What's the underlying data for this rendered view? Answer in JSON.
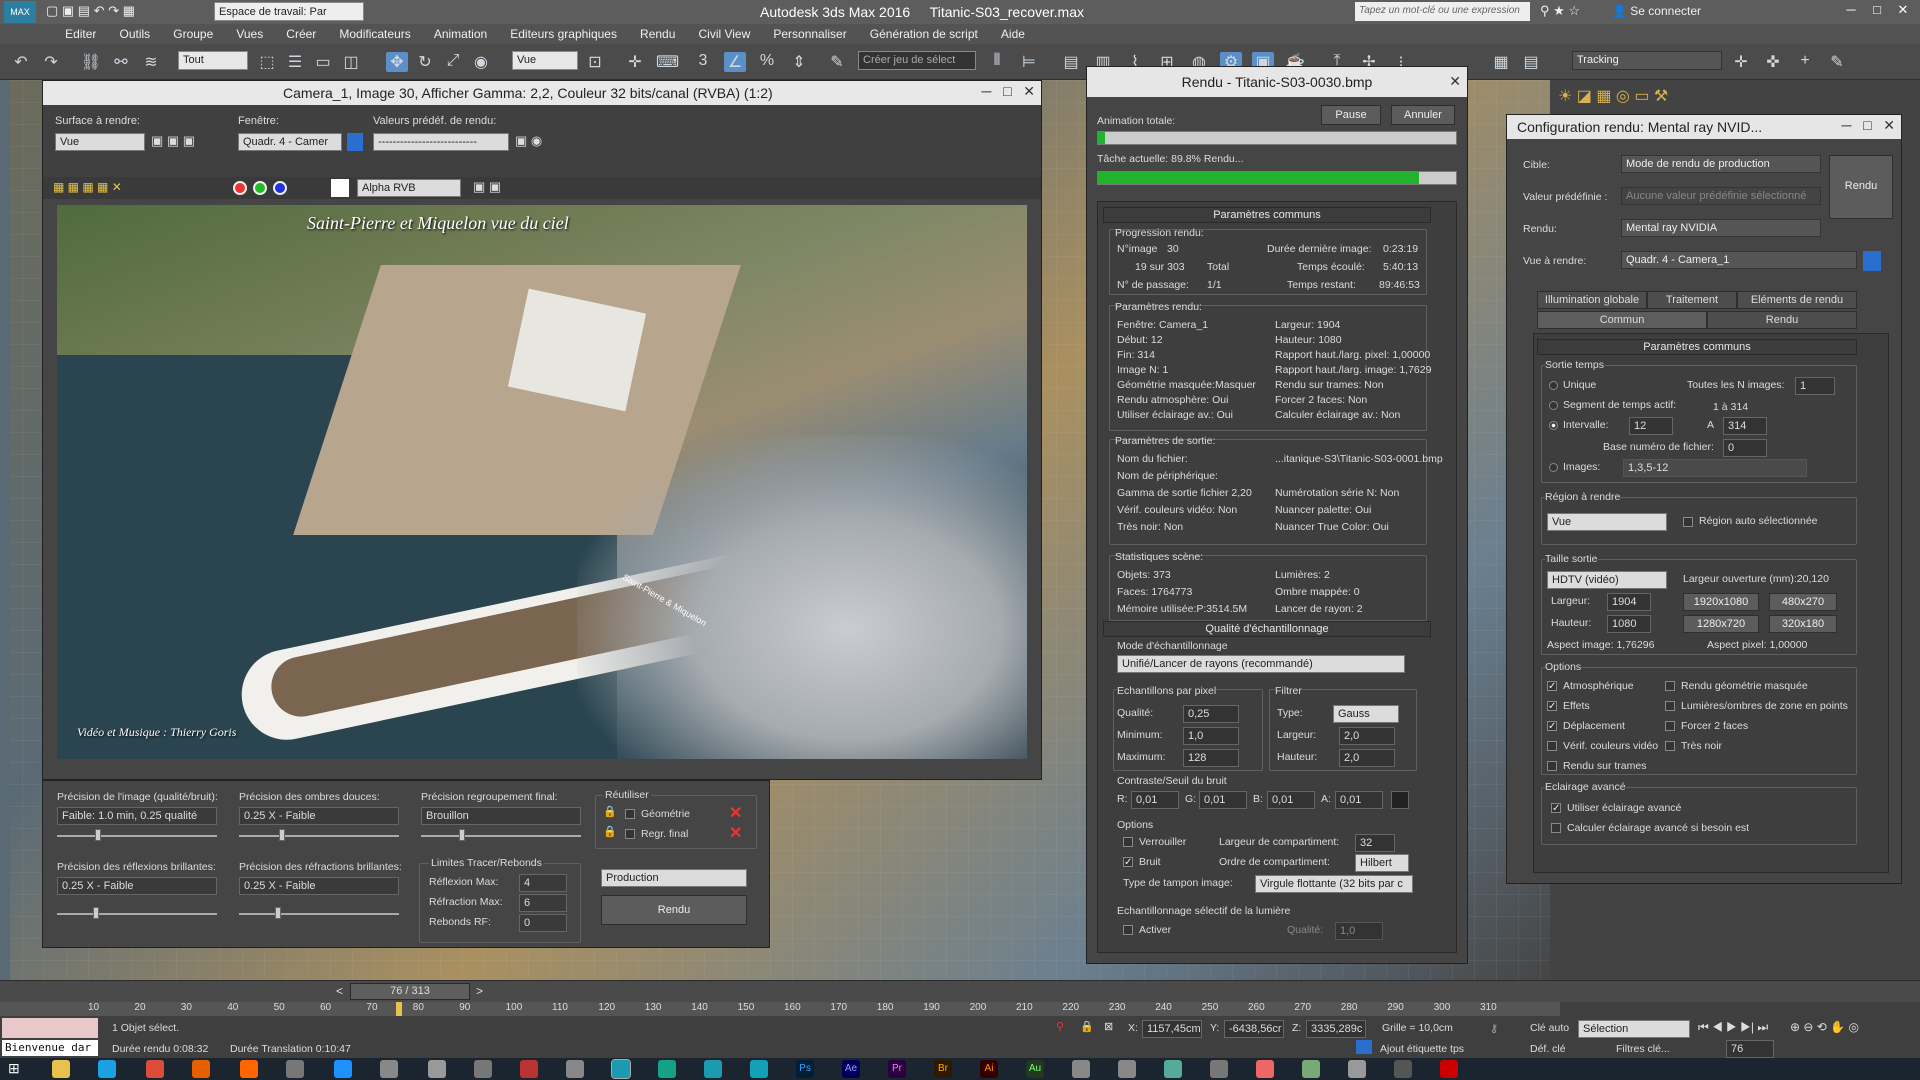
{
  "app": {
    "title": "Autodesk 3ds Max 2016",
    "file": "Titanic-S03_recover.max",
    "workspace": "Espace de travail: Par",
    "search_placeholder": "Tapez un mot-clé ou une expression",
    "connect": "Se connecter"
  },
  "menu": [
    "Editer",
    "Outils",
    "Groupe",
    "Vues",
    "Créer",
    "Modificateurs",
    "Animation",
    "Editeurs graphiques",
    "Rendu",
    "Civil View",
    "Personnaliser",
    "Génération de script",
    "Aide"
  ],
  "toolbar": {
    "selection_filter": "Tout",
    "view_ref": "Vue",
    "named_sel": "Créer jeu de sélect",
    "tracking": "Tracking"
  },
  "framewin": {
    "title": "Camera_1, Image 30, Afficher Gamma: 2,2, Couleur 32 bits/canal (RVBA) (1:2)",
    "area_label": "Surface à rendre:",
    "area_value": "Vue",
    "window_label": "Fenêtre:",
    "window_value": "Quadr. 4 - Camer",
    "preset_label": "Valeurs prédéf. de rendu:",
    "preset_value": "---------------------------",
    "channel": "Alpha RVB",
    "caption": "Saint-Pierre et Miquelon vue du ciel",
    "credit": "Vidéo et Musique : Thierry Goris",
    "ship_text": "Saint-Pierre & Miquelon"
  },
  "fg": {
    "img_prec_label": "Précision de l'image (qualité/bruit):",
    "img_prec_value": "Faible: 1.0 min, 0.25 qualité",
    "soft_shadow_label": "Précision des ombres douces:",
    "soft_shadow_value": "0.25 X - Faible",
    "final_gather_label": "Précision regroupement final:",
    "final_gather_value": "Brouillon",
    "glossy_refl_label": "Précision des réflexions brillantes:",
    "glossy_refl_value": "0.25 X - Faible",
    "glossy_refr_label": "Précision des réfractions brillantes:",
    "glossy_refr_value": "0.25 X - Faible",
    "trace_label": "Limites Tracer/Rebonds",
    "refl_max_label": "Réflexion Max:",
    "refl_max": "4",
    "refr_max_label": "Réfraction Max:",
    "refr_max": "6",
    "bounces_label": "Rebonds RF:",
    "bounces": "0",
    "reuse_label": "Réutiliser",
    "geometry": "Géométrie",
    "final_reg": "Regr. final",
    "mode": "Production",
    "render": "Rendu"
  },
  "render": {
    "title": "Rendu - Titanic-S03-0030.bmp",
    "anim_total": "Animation totale:",
    "pause": "Pause",
    "cancel": "Annuler",
    "anim_progress": 0.02,
    "task": "Tâche actuelle: 89.8% Rendu...",
    "task_progress": 0.898,
    "common": "Paramètres communs",
    "prog_title": "Progression rendu:",
    "prog": [
      [
        "N°image",
        "30"
      ],
      [
        "Durée dernière image:",
        "0:23:19"
      ],
      [
        "19 sur 303",
        "Total"
      ],
      [
        "Temps écoulé:",
        "5:40:13"
      ],
      [
        "N° de passage:",
        "1/1"
      ],
      [
        "Temps restant:",
        "89:46:53"
      ]
    ],
    "rp_title": "Paramètres rendu:",
    "rp": [
      [
        "Fenêtre: Camera_1",
        "Largeur: 1904"
      ],
      [
        "Début: 12",
        "Hauteur: 1080"
      ],
      [
        "Fin: 314",
        "Rapport haut./larg. pixel: 1,00000"
      ],
      [
        "Image N: 1",
        "Rapport haut./larg. image: 1,7629"
      ],
      [
        "Géométrie masquée:Masquer",
        "Rendu sur trames: Non"
      ],
      [
        "Rendu atmosphère: Oui",
        "Forcer 2 faces: Non"
      ],
      [
        "Utiliser éclairage av.: Oui",
        "Calculer éclairage av.: Non"
      ]
    ],
    "out_title": "Paramètres de sortie:",
    "out": [
      [
        "Nom du fichier:",
        "...itanique-S3\\Titanic-S03-0001.bmp"
      ],
      [
        "Nom de périphérique:",
        ""
      ],
      [
        "Gamma de sortie fichier 2,20",
        "Numérotation série N: Non"
      ],
      [
        "Vérif. couleurs vidéo: Non",
        "Nuancer palette: Oui"
      ],
      [
        "Très noir: Non",
        "Nuancer True Color: Oui"
      ]
    ],
    "stats_title": "Statistiques scène:",
    "stats": [
      [
        "Objets: 373",
        "Lumières: 2"
      ],
      [
        "Faces: 1764773",
        "Ombre mappée: 0"
      ],
      [
        "Mémoire utilisée:P:3514.5M",
        "Lancer de rayon: 2"
      ]
    ],
    "sq_title": "Qualité d'échantillonnage",
    "mode_label": "Mode d'échantillonnage",
    "mode": "Unifié/Lancer de rayons (recommandé)",
    "spp": "Echantillons par pixel",
    "q_label": "Qualité:",
    "q": "0,25",
    "min_label": "Minimum:",
    "min": "1,0",
    "max_label": "Maximum:",
    "max": "128",
    "filter": "Filtrer",
    "type_label": "Type:",
    "type": "Gauss",
    "w_label": "Largeur:",
    "w": "2,0",
    "h_label": "Hauteur:",
    "h": "2,0",
    "contrast": "Contraste/Seuil du bruit",
    "r": "0,01",
    "g": "0,01",
    "b": "0,01",
    "a": "0,01",
    "options": "Options",
    "lock": "Verrouiller",
    "noise": "Bruit",
    "bucket_w_label": "Largeur de compartiment:",
    "bucket_w": "32",
    "bucket_o_label": "Ordre de compartiment:",
    "bucket_o": "Hilbert",
    "buffer_label": "Type de tampon image:",
    "buffer": "Virgule flottante (32 bits par c",
    "light_sample": "Echantillonnage sélectif de la lumière",
    "activate": "Activer",
    "quality2": "Qualité:",
    "quality2_val": "1,0"
  },
  "config": {
    "title": "Configuration rendu: Mental ray NVID...",
    "target_label": "Cible:",
    "target": "Mode de rendu de production",
    "preset_label": "Valeur prédéfinie :",
    "preset": "Aucune valeur prédéfinie sélectionné",
    "renderer_label": "Rendu:",
    "renderer": "Mental ray NVIDIA",
    "view_label": "Vue à rendre:",
    "view": "Quadr. 4 - Camera_1",
    "render_btn": "Rendu",
    "tabs1": [
      "Illumination globale",
      "Traitement",
      "Eléments de rendu"
    ],
    "tabs2": [
      "Commun",
      "Rendu"
    ],
    "common": "Paramètres communs",
    "time_out": "Sortie temps",
    "single": "Unique",
    "every_n": "Toutes les N images:",
    "every_n_val": "1",
    "active_seg": "Segment de temps actif:",
    "active_seg_val": "1 à 314",
    "range": "Intervalle:",
    "range_from": "12",
    "range_to_label": "A",
    "range_to": "314",
    "file_base": "Base numéro de fichier:",
    "file_base_val": "0",
    "frames": "Images:",
    "frames_val": "1,3,5-12",
    "region": "Région à rendre",
    "region_val": "Vue",
    "auto_region": "Région auto sélectionnée",
    "out_size": "Taille sortie",
    "size_preset": "HDTV (vidéo)",
    "aperture": "Largeur ouverture (mm):20,120",
    "width_label": "Largeur:",
    "width": "1904",
    "height_label": "Hauteur:",
    "height": "1080",
    "presets": [
      "1920x1080",
      "480x270",
      "1280x720",
      "320x180"
    ],
    "aspect_img": "Aspect image: 1,76296",
    "aspect_px": "Aspect pixel: 1,00000",
    "options": "Options",
    "opts": [
      "Atmosphérique",
      "Rendu géométrie masquée",
      "Effets",
      "Lumières/ombres de zone en points",
      "Déplacement",
      "Forcer 2 faces",
      "Vérif. couleurs vidéo",
      "Très noir",
      "Rendu sur trames"
    ],
    "adv": "Eclairage avancé",
    "adv_use": "Utiliser éclairage avancé",
    "adv_calc": "Calculer éclairage avancé si besoin est"
  },
  "timeline": {
    "frame": "76 / 313",
    "ticks": [
      "10",
      "20",
      "30",
      "40",
      "50",
      "60",
      "70",
      "80",
      "90",
      "100",
      "110",
      "120",
      "130",
      "140",
      "150",
      "160",
      "170",
      "180",
      "190",
      "200",
      "210",
      "220",
      "230",
      "240",
      "250",
      "260",
      "270",
      "280",
      "290",
      "300",
      "310"
    ]
  },
  "status": {
    "welcome": "Bienvenue dar",
    "selected": "1 Objet sélect.",
    "render_time": "Durée rendu 0:08:32",
    "translate_time": "Durée Translation 0:10:47",
    "x": "1157,45cm",
    "y": "-6438,56cr",
    "z": "3335,289c",
    "grid": "Grille = 10,0cm",
    "add_tag": "Ajout étiquette tps",
    "auto_key": "Clé auto",
    "set_key": "Déf. clé",
    "selection": "Sélection",
    "key_filters": "Filtres clé...",
    "current_frame": "76"
  }
}
